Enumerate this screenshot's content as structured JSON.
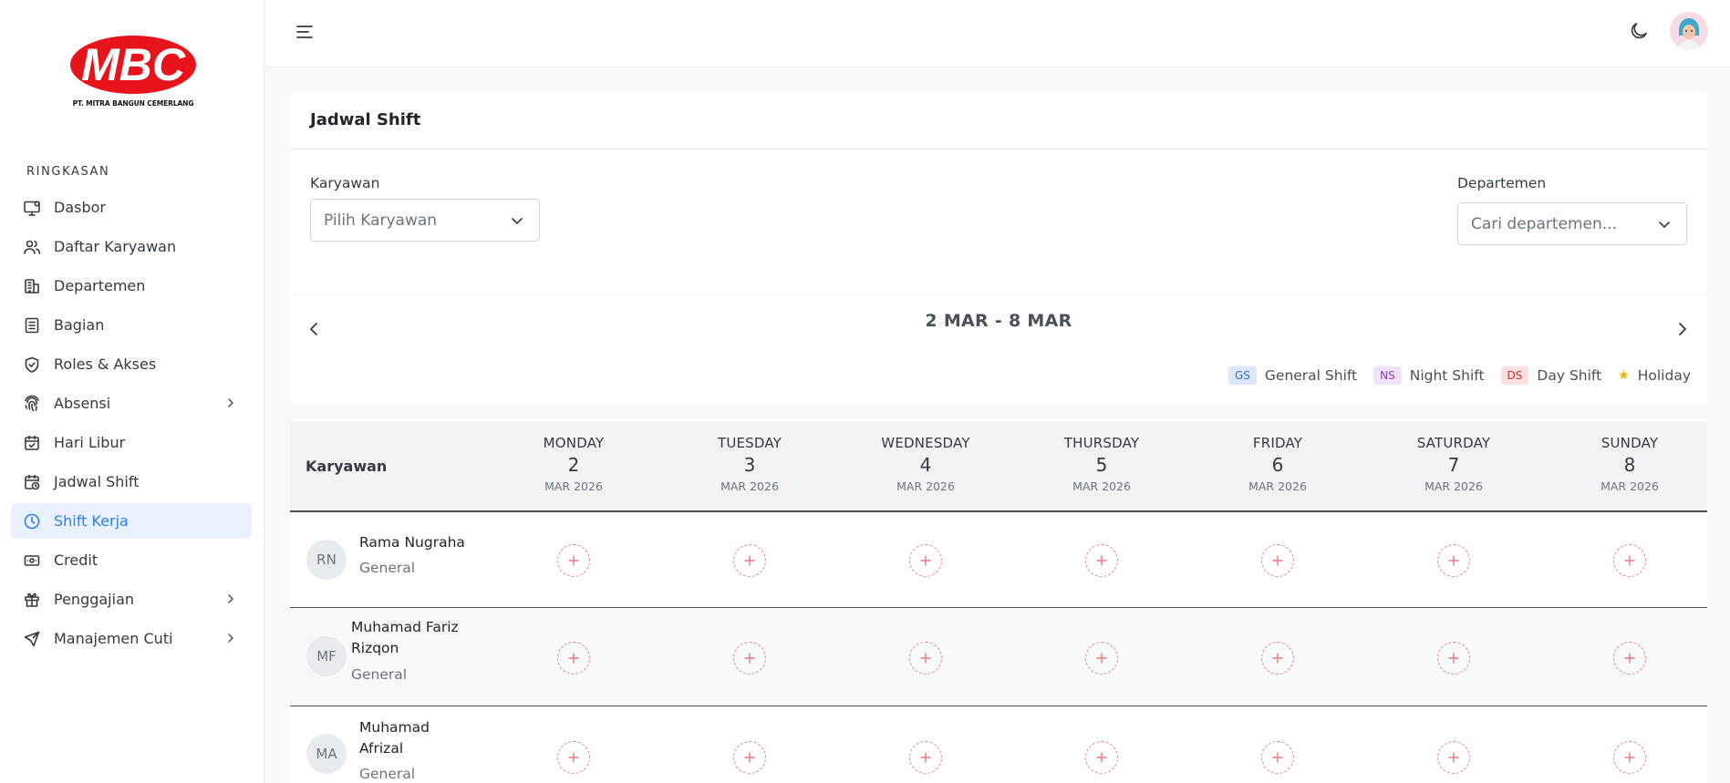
{
  "brand": {
    "logo_text": "MBC",
    "company": "PT. MITRA BANGUN CEMERLANG",
    "accent": "#e8141c"
  },
  "sidebar": {
    "section": "RINGKASAN",
    "items": [
      {
        "label": "Dasbor",
        "icon": "monitor-icon"
      },
      {
        "label": "Daftar Karyawan",
        "icon": "users-icon"
      },
      {
        "label": "Departemen",
        "icon": "building-icon"
      },
      {
        "label": "Bagian",
        "icon": "list-icon"
      },
      {
        "label": "Roles & Akses",
        "icon": "shield-icon"
      },
      {
        "label": "Absensi",
        "icon": "fingerprint-icon",
        "chevron": true
      },
      {
        "label": "Hari Libur",
        "icon": "calendar-check-icon"
      },
      {
        "label": "Jadwal Shift",
        "icon": "calendar-clock-icon"
      },
      {
        "label": "Shift Kerja",
        "icon": "clock-icon",
        "active": true
      },
      {
        "label": "Credit",
        "icon": "cash-icon"
      },
      {
        "label": "Penggajian",
        "icon": "gift-icon",
        "chevron": true
      },
      {
        "label": "Manajemen Cuti",
        "icon": "plane-icon",
        "chevron": true
      }
    ]
  },
  "page": {
    "title": "Jadwal Shift",
    "employee_label": "Karyawan",
    "employee_placeholder": "Pilih Karyawan",
    "department_label": "Departemen",
    "department_placeholder": "Cari departemen...",
    "week_range": "2 MAR - 8 MAR"
  },
  "legend": [
    {
      "code": "GS",
      "label": "General Shift",
      "bg": "#dbe7fb",
      "fg": "#3b6fc9"
    },
    {
      "code": "NS",
      "label": "Night Shift",
      "bg": "#efe3f9",
      "fg": "#8a3fc0"
    },
    {
      "code": "DS",
      "label": "Day Shift",
      "bg": "#fbdfe0",
      "fg": "#c9343a"
    }
  ],
  "holiday_label": "Holiday",
  "schedule": {
    "employee_header": "Karyawan",
    "days": [
      {
        "name": "MONDAY",
        "num": "2",
        "month": "MAR 2026"
      },
      {
        "name": "TUESDAY",
        "num": "3",
        "month": "MAR 2026"
      },
      {
        "name": "WEDNESDAY",
        "num": "4",
        "month": "MAR 2026"
      },
      {
        "name": "THURSDAY",
        "num": "5",
        "month": "MAR 2026"
      },
      {
        "name": "FRIDAY",
        "num": "6",
        "month": "MAR 2026"
      },
      {
        "name": "SATURDAY",
        "num": "7",
        "month": "MAR 2026"
      },
      {
        "name": "SUNDAY",
        "num": "8",
        "month": "MAR 2026"
      }
    ],
    "employees": [
      {
        "initials": "RN",
        "name_lines": [
          "Rama Nugraha"
        ],
        "dept": "General"
      },
      {
        "initials": "MF",
        "name_lines": [
          "Muhamad Fariz",
          "Rizqon"
        ],
        "dept": "General"
      },
      {
        "initials": "MA",
        "name_lines": [
          "Muhamad",
          "Afrizal"
        ],
        "dept": "General"
      }
    ]
  }
}
